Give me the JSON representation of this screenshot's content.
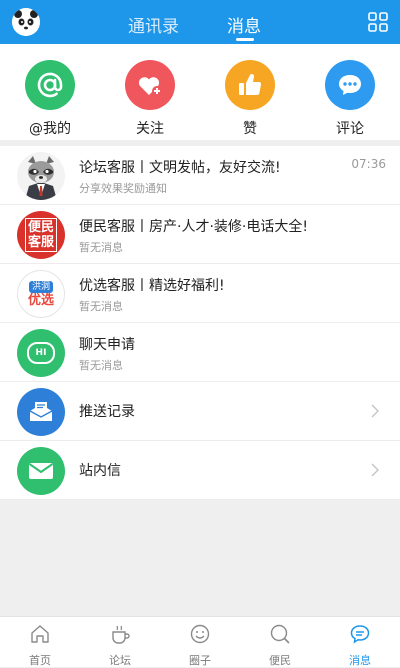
{
  "header": {
    "tabs": [
      {
        "label": "通讯录",
        "active": false
      },
      {
        "label": "消息",
        "active": true
      }
    ]
  },
  "quick_actions": [
    {
      "label": "@我的",
      "icon": "at-icon",
      "color": "#2fbf6f"
    },
    {
      "label": "关注",
      "icon": "heart-plus-icon",
      "color": "#f0575d"
    },
    {
      "label": "赞",
      "icon": "thumbs-up-icon",
      "color": "#f7a623"
    },
    {
      "label": "评论",
      "icon": "comment-icon",
      "color": "#2e9bf0"
    }
  ],
  "messages": [
    {
      "title": "论坛客服丨文明发帖，友好交流!",
      "subtitle": "分享效果奖励通知",
      "time": "07:36",
      "avatar": "raccoon-avatar"
    },
    {
      "title": "便民客服丨房产·人才·装修·电话大全!",
      "subtitle": "暂无消息",
      "time": "",
      "avatar": "bianmin-kefu-avatar",
      "avatar_text": [
        "便民",
        "客服"
      ]
    },
    {
      "title": "优选客服丨精选好福利!",
      "subtitle": "暂无消息",
      "time": "",
      "avatar": "youxuan-avatar",
      "avatar_text": [
        "洪洞",
        "优选"
      ]
    },
    {
      "title": "聊天申请",
      "subtitle": "暂无消息",
      "time": "",
      "avatar": "hi-chat-avatar",
      "avatar_text": [
        "HI"
      ]
    }
  ],
  "links": [
    {
      "title": "推送记录",
      "icon": "inbox-icon",
      "color": "#2e7fd8"
    },
    {
      "title": "站内信",
      "icon": "envelope-icon",
      "color": "#2fbf6f"
    }
  ],
  "bottom_nav": [
    {
      "label": "首页",
      "icon": "home-icon",
      "active": false
    },
    {
      "label": "论坛",
      "icon": "cup-icon",
      "active": false
    },
    {
      "label": "圈子",
      "icon": "smile-circle-icon",
      "active": false
    },
    {
      "label": "便民",
      "icon": "search-circle-icon",
      "active": false
    },
    {
      "label": "消息",
      "icon": "message-bubble-icon",
      "active": true
    }
  ],
  "colors": {
    "primary": "#1e97ea",
    "background": "#efefef"
  }
}
